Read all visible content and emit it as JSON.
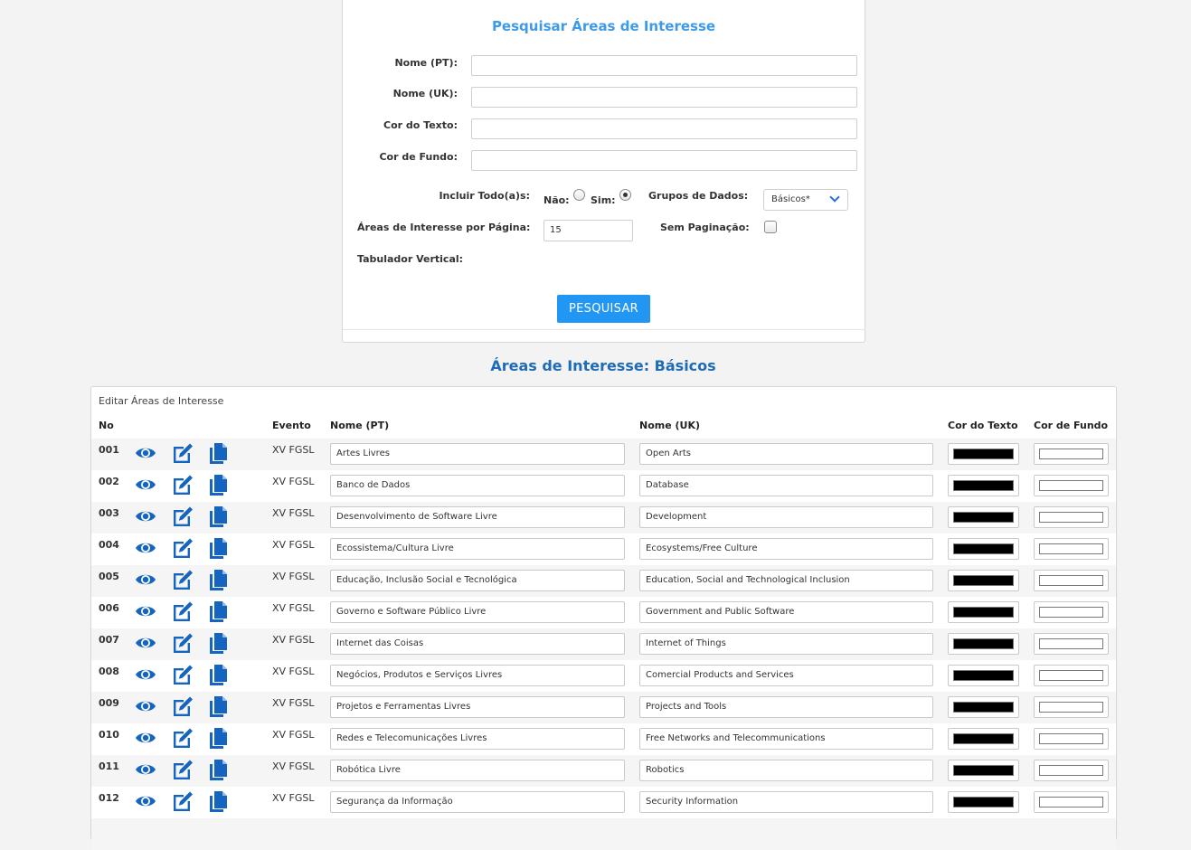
{
  "search": {
    "title": "Pesquisar Áreas de Interesse",
    "fields": [
      {
        "label": "Nome (PT):",
        "value": ""
      },
      {
        "label": "Nome (UK):",
        "value": ""
      },
      {
        "label": "Cor do Texto:",
        "value": ""
      },
      {
        "label": "Cor de Fundo:",
        "value": ""
      }
    ],
    "include_all_label": "Incluir Todo(a)s:",
    "include_no_label": "Não:",
    "include_yes_label": "Sim:",
    "include_selected": "Sim",
    "data_groups_label": "Grupos de Dados:",
    "data_groups_value": "Básicos*",
    "per_page_label": "Áreas de Interesse por Página:",
    "per_page_value": "15",
    "no_pagination_label": "Sem Paginação:",
    "no_pagination_checked": false,
    "vertical_tab_label": "Tabulador Vertical:",
    "submit_label": "PESQUISAR"
  },
  "results": {
    "title": "Áreas de Interesse: Básicos",
    "caption": "Editar Áreas de Interesse",
    "headers": {
      "no": "No",
      "event": "Evento",
      "name_pt": "Nome (PT)",
      "name_uk": "Nome (UK)",
      "text_color": "Cor do Texto",
      "bg_color": "Cor de Fundo"
    },
    "icons": {
      "view": "eye-icon",
      "edit": "edit-icon",
      "copy": "copy-icon"
    },
    "accent_color": "#1565c0",
    "rows": [
      {
        "no": "001",
        "event": "XV FGSL",
        "name_pt": "Artes Livres",
        "name_uk": "Open Arts",
        "text_color": "#000000",
        "bg_color": "#ffffff"
      },
      {
        "no": "002",
        "event": "XV FGSL",
        "name_pt": "Banco de Dados",
        "name_uk": "Database",
        "text_color": "#000000",
        "bg_color": "#ffffff"
      },
      {
        "no": "003",
        "event": "XV FGSL",
        "name_pt": "Desenvolvimento de Software Livre",
        "name_uk": "Development",
        "text_color": "#000000",
        "bg_color": "#ffffff"
      },
      {
        "no": "004",
        "event": "XV FGSL",
        "name_pt": "Ecossistema/Cultura Livre",
        "name_uk": "Ecosystems/Free Culture",
        "text_color": "#000000",
        "bg_color": "#ffffff"
      },
      {
        "no": "005",
        "event": "XV FGSL",
        "name_pt": "Educação, Inclusão Social e Tecnológica",
        "name_uk": "Education, Social and Technological Inclusion",
        "text_color": "#000000",
        "bg_color": "#ffffff"
      },
      {
        "no": "006",
        "event": "XV FGSL",
        "name_pt": "Governo e Software Público Livre",
        "name_uk": "Government and Public Software",
        "text_color": "#000000",
        "bg_color": "#ffffff"
      },
      {
        "no": "007",
        "event": "XV FGSL",
        "name_pt": "Internet das Coisas",
        "name_uk": "Internet of Things",
        "text_color": "#000000",
        "bg_color": "#ffffff"
      },
      {
        "no": "008",
        "event": "XV FGSL",
        "name_pt": "Negócios, Produtos e Serviços Livres",
        "name_uk": "Comercial Products and Services",
        "text_color": "#000000",
        "bg_color": "#ffffff"
      },
      {
        "no": "009",
        "event": "XV FGSL",
        "name_pt": "Projetos e Ferramentas Livres",
        "name_uk": "Projects and Tools",
        "text_color": "#000000",
        "bg_color": "#ffffff"
      },
      {
        "no": "010",
        "event": "XV FGSL",
        "name_pt": "Redes e Telecomunicações Livres",
        "name_uk": "Free Networks and Telecommunications",
        "text_color": "#000000",
        "bg_color": "#ffffff"
      },
      {
        "no": "011",
        "event": "XV FGSL",
        "name_pt": "Robótica Livre",
        "name_uk": "Robotics",
        "text_color": "#000000",
        "bg_color": "#ffffff"
      },
      {
        "no": "012",
        "event": "XV FGSL",
        "name_pt": "Segurança da Informação",
        "name_uk": "Security Information",
        "text_color": "#000000",
        "bg_color": "#ffffff"
      }
    ]
  }
}
